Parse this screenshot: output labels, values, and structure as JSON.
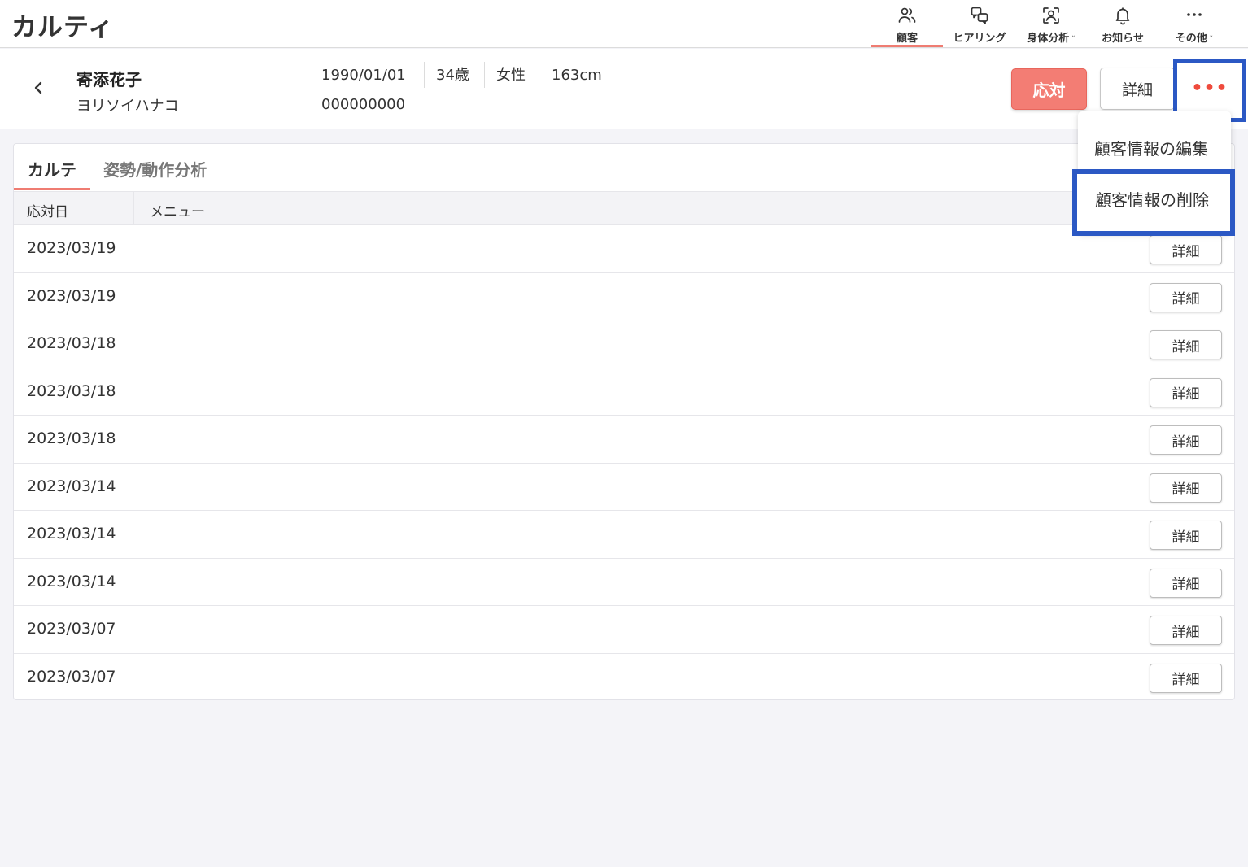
{
  "app": {
    "title": "カルティ"
  },
  "nav": [
    {
      "label": "顧客",
      "icon": "users-icon",
      "active": true
    },
    {
      "label": "ヒアリング",
      "icon": "chat-icon"
    },
    {
      "label": "身体分析",
      "icon": "body-scan-icon",
      "dropdown": true
    },
    {
      "label": "お知らせ",
      "icon": "bell-icon"
    },
    {
      "label": "その他",
      "icon": "more-icon",
      "dropdown": true
    }
  ],
  "customer": {
    "name": "寄添花子",
    "kana": "ヨリソイハナコ",
    "birthdate": "1990/01/01",
    "age": "34歳",
    "gender": "女性",
    "height": "163cm",
    "id": "000000000"
  },
  "actions": {
    "respond_label": "応対",
    "detail_label": "詳細",
    "more_label": "•••"
  },
  "menu": {
    "edit_label": "顧客情報の編集",
    "delete_label": "顧客情報の削除"
  },
  "tabs": [
    {
      "label": "カルテ",
      "active": true
    },
    {
      "label": "姿勢/動作分析"
    }
  ],
  "table": {
    "headers": [
      "応対日",
      "メニュー"
    ],
    "row_button_label": "詳細",
    "rows": [
      {
        "date": "2023/03/19",
        "menu": ""
      },
      {
        "date": "2023/03/19",
        "menu": ""
      },
      {
        "date": "2023/03/18",
        "menu": ""
      },
      {
        "date": "2023/03/18",
        "menu": ""
      },
      {
        "date": "2023/03/18",
        "menu": ""
      },
      {
        "date": "2023/03/14",
        "menu": ""
      },
      {
        "date": "2023/03/14",
        "menu": ""
      },
      {
        "date": "2023/03/14",
        "menu": ""
      },
      {
        "date": "2023/03/07",
        "menu": ""
      },
      {
        "date": "2023/03/07",
        "menu": ""
      }
    ]
  },
  "colors": {
    "accent": "#ef7c72",
    "primary_button": "#f37d74",
    "highlight": "#2b58c4"
  }
}
